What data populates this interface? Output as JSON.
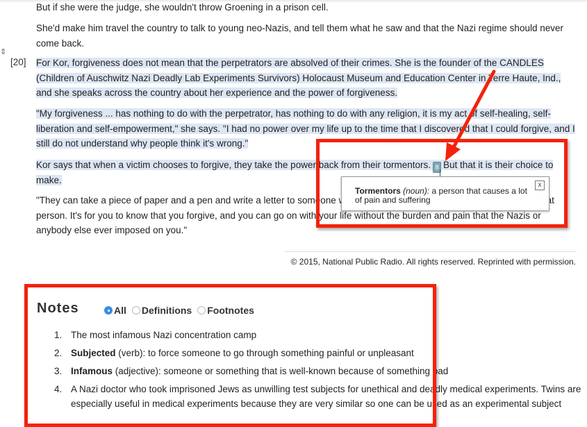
{
  "article": {
    "paragraphs": [
      {
        "text": "But if she were the judge, she wouldn't throw Groening in a prison cell."
      },
      {
        "text": "She'd make him travel the country to talk to young neo-Nazis, and tell them what he saw and that the Nazi regime should never come back."
      },
      {
        "number": "[20]",
        "text": "For Kor, forgiveness does not mean that the perpetrators are absolved of their crimes. She is the founder of the CANDLES (Children of Auschwitz Nazi Deadly Lab Experiments Survivors) Holocaust Museum and Education Center in Terre Haute, Ind., and she speaks across the country about her experience and the power of forgiveness."
      },
      {
        "text": "\"My forgiveness ... has nothing to do with the perpetrator, has nothing to do with any religion, it is my act of self-healing, self-liberation and self-empowerment,\" she says. \"I had no power over my life up to the time that I discovered that I could forgive, and I still do not understand why people think it's wrong.\""
      },
      {
        "text_before": "Kor says that when a victim chooses to forgive, they take the power back from their tormentors.",
        "footnote_marker": "8",
        "text_after": "But that it is their choice to make."
      },
      {
        "text": "\"They can take a piece of paper and a pen and write a letter to someone who hurt them, and they don't have to send it to that person. It's for you to know that you forgive, and you can go on with your life without the burden and pain that the Nazis or anybody else ever imposed on you.\""
      }
    ],
    "copyright": "© 2015, National Public Radio. All rights reserved. Reprinted with permission."
  },
  "popup": {
    "term": "Tormentors",
    "pos": "(noun):",
    "definition": " a person that causes a lot of pain and suffering",
    "close_label": "x"
  },
  "notes": {
    "title": "Notes",
    "filters": [
      {
        "label": "All",
        "checked": true
      },
      {
        "label": "Definitions",
        "checked": false
      },
      {
        "label": "Footnotes",
        "checked": false
      }
    ],
    "items": [
      {
        "num": "1.",
        "term": "",
        "rest": "The most infamous Nazi concentration camp"
      },
      {
        "num": "2.",
        "term": "Subjected",
        "rest": " (verb): to force someone to go through something painful or unpleasant"
      },
      {
        "num": "3.",
        "term": "Infamous",
        "rest": " (adjective): someone or something that is well-known because of something bad"
      },
      {
        "num": "4.",
        "term": "",
        "rest": "A Nazi doctor who took imprisoned Jews as unwilling test subjects for unethical and deadly medical experiments. Twins are especially useful in medical experiments because they are very similar so one can be used as an experimental subject"
      }
    ]
  },
  "annotation_color": "#f4220b",
  "highlight_color": "#dde6f3"
}
